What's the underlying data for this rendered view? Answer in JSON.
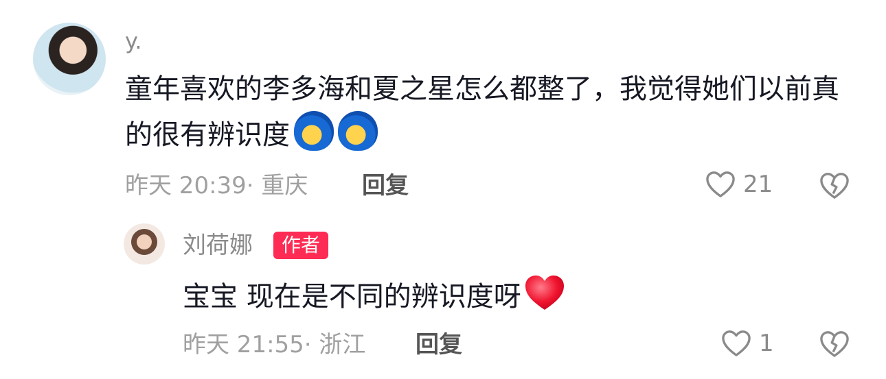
{
  "comment": {
    "username": "y.",
    "text": "童年喜欢的李多海和夏之星怎么都整了，我觉得她们以前真的很有辨识度",
    "emojis": [
      "blue-face-emoji",
      "blue-face-emoji"
    ],
    "time_location": "昨天 20:39· 重庆",
    "reply_label": "回复",
    "likes": "21"
  },
  "reply": {
    "username": "刘荷娜",
    "badge": "作者",
    "text": "宝宝 现在是不同的辨识度呀",
    "emojis": [
      "red-heart-emoji"
    ],
    "time_location": "昨天 21:55· 浙江",
    "reply_label": "回复",
    "likes": "1"
  },
  "colors": {
    "accent": "#fe2c55",
    "text": "#161823",
    "muted": "#a0a0a0"
  }
}
